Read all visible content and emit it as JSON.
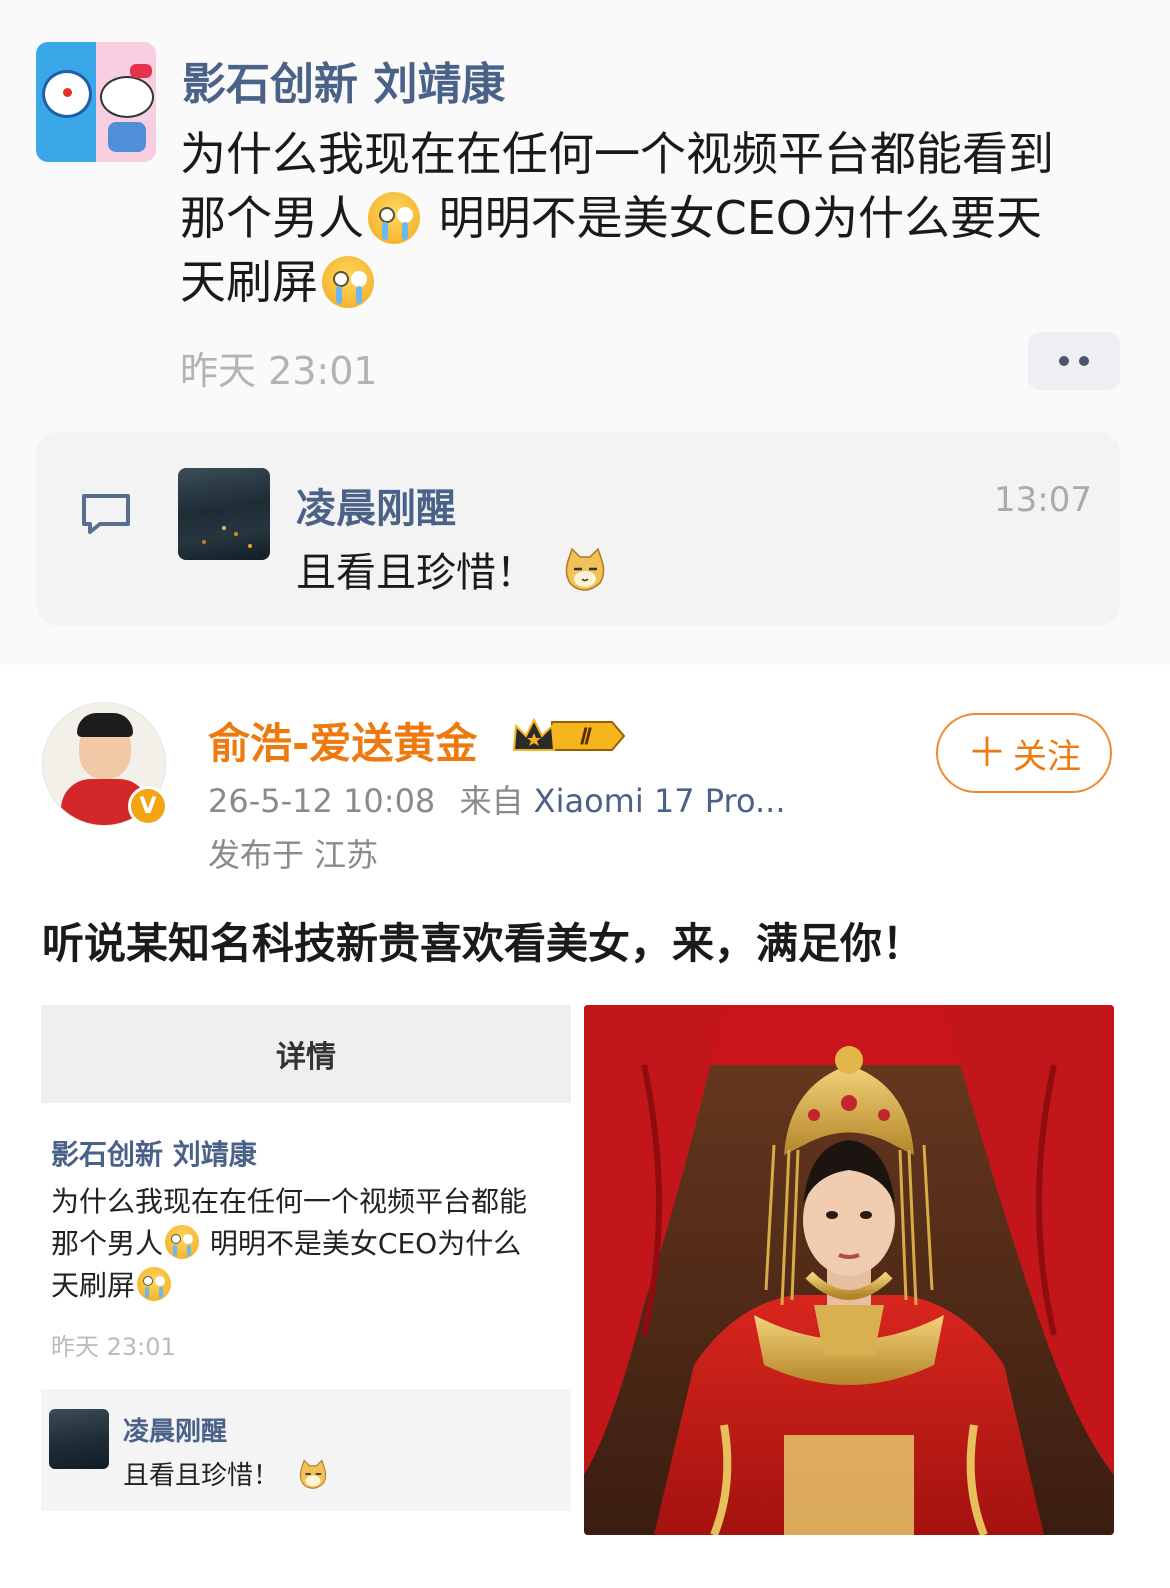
{
  "top_comment": {
    "author": "影石创新 刘靖康",
    "text_line1": "为什么我现在在任何一个视频平台都能看到",
    "text_line2a": "那个男人",
    "text_line2b": " 明明不是美女CEO为什么要天",
    "text_line3": "天刷屏",
    "time": "昨天 23:01",
    "reply": {
      "author": "凌晨刚醒",
      "time": "13:07",
      "text": "且看且珍惜！"
    }
  },
  "post": {
    "author": "俞浩-爱送黄金",
    "level_badge": "Ⅱ",
    "verified_badge": "V",
    "date": "26-5-12 10:08",
    "from_label": "来自",
    "source": "Xiaomi 17 Pro...",
    "location": "发布于 江苏",
    "follow_label": "关注",
    "body": "听说某知名科技新贵喜欢看美女，来，满足你！"
  },
  "embedded": {
    "header": "详情",
    "author": "影石创新 刘靖康",
    "text_line1": "为什么我现在在任何一个视频平台都能",
    "text_line2a": "那个男人",
    "text_line2b": " 明明不是美女CEO为什么",
    "text_line3": "天刷屏",
    "time": "昨天 23:01",
    "reply_author": "凌晨刚醒",
    "reply_text": "且看且珍惜！"
  },
  "colors": {
    "link_blue": "#4a6188",
    "accent_orange": "#ee7a0f",
    "muted_gray": "#b3b3b3"
  },
  "icons": [
    "comment-icon",
    "more-dots-icon",
    "crying-emoji-icon",
    "cat-emoji-icon",
    "crown-icon",
    "verified-icon",
    "plus-icon"
  ]
}
